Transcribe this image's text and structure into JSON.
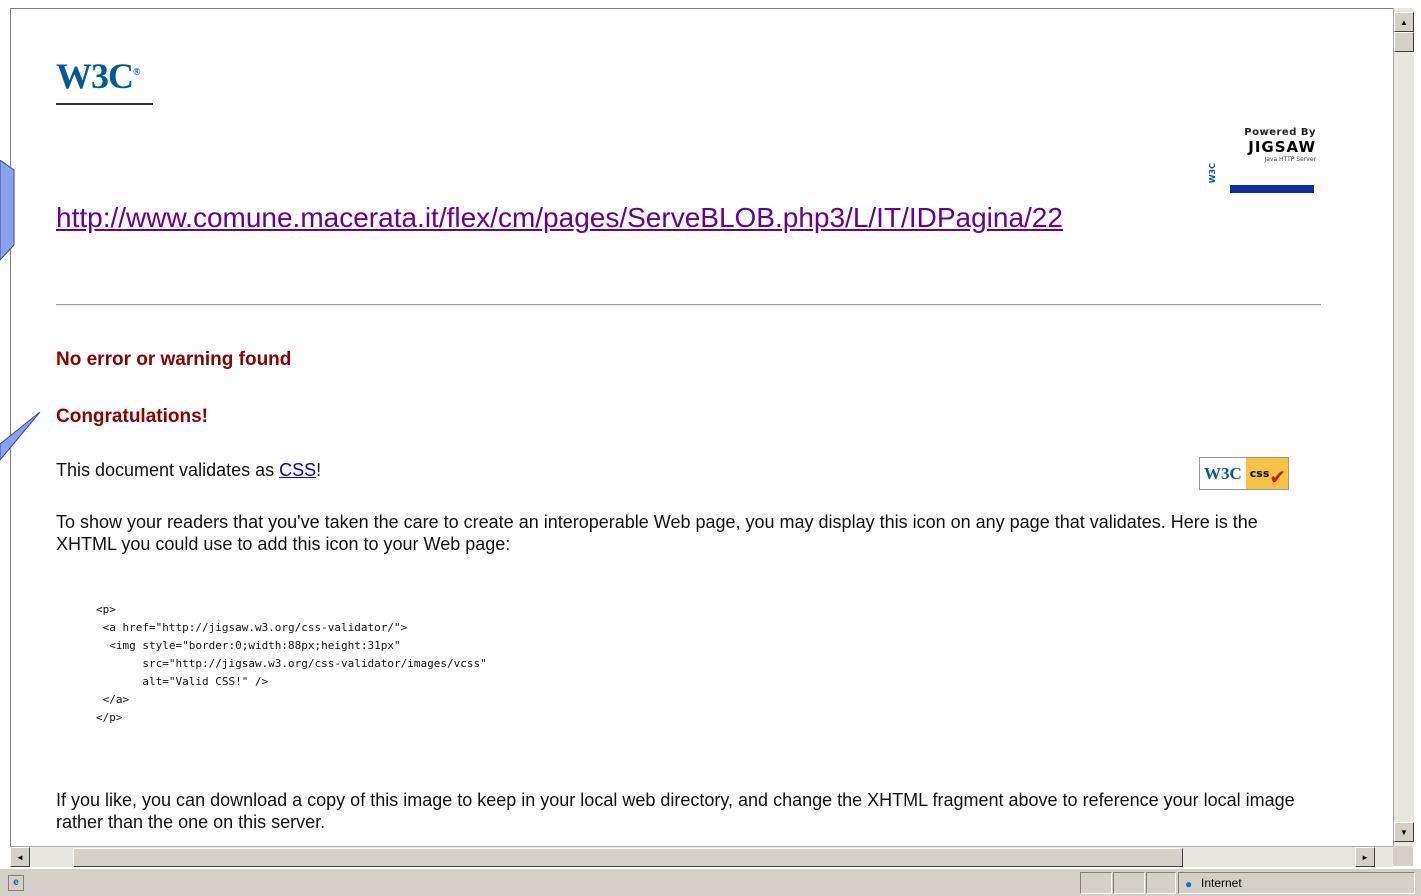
{
  "logo": {
    "text": "W3C",
    "mark": "®"
  },
  "powered_by": {
    "line1": "Powered By",
    "line2": "JIGSAW",
    "line3": "Java HTTP Server",
    "w3c": "W3C"
  },
  "validated_url": "http://www.comune.macerata.it/flex/cm/pages/ServeBLOB.php3/L/IT/IDPagina/22",
  "messages": {
    "no_error": "No error or warning found",
    "congrats": "Congratulations!"
  },
  "validates": {
    "prefix": "This document validates as ",
    "link": "CSS",
    "suffix": "!"
  },
  "badge": {
    "w3c": "W3C",
    "css": "css",
    "check": "✔"
  },
  "show_readers": "To show your readers that you've taken the care to create an interoperable Web page, you may display this icon on any page that validates. Here is the XHTML you could use to add this icon to your Web page:",
  "code_snippet": "<p>\n <a href=\"http://jigsaw.w3.org/css-validator/\">\n  <img style=\"border:0;width:88px;height:31px\"\n       src=\"http://jigsaw.w3.org/css-validator/images/vcss\"\n       alt=\"Valid CSS!\" />\n </a>\n</p>",
  "download_note": "If you like, you can download a copy of this image to keep in your local web directory, and change the XHTML fragment above to reference your local image rather than the one on this server.",
  "scrollbars": {
    "up": "▲",
    "down": "▼",
    "left": "◄",
    "right": "►"
  },
  "statusbar": {
    "ie_icon": "e",
    "zone_icon": "●",
    "zone_label": "Internet"
  },
  "colors": {
    "link_visited": "#660099",
    "heading_red": "#8b0000",
    "callout_blue": "#8da0f0"
  }
}
